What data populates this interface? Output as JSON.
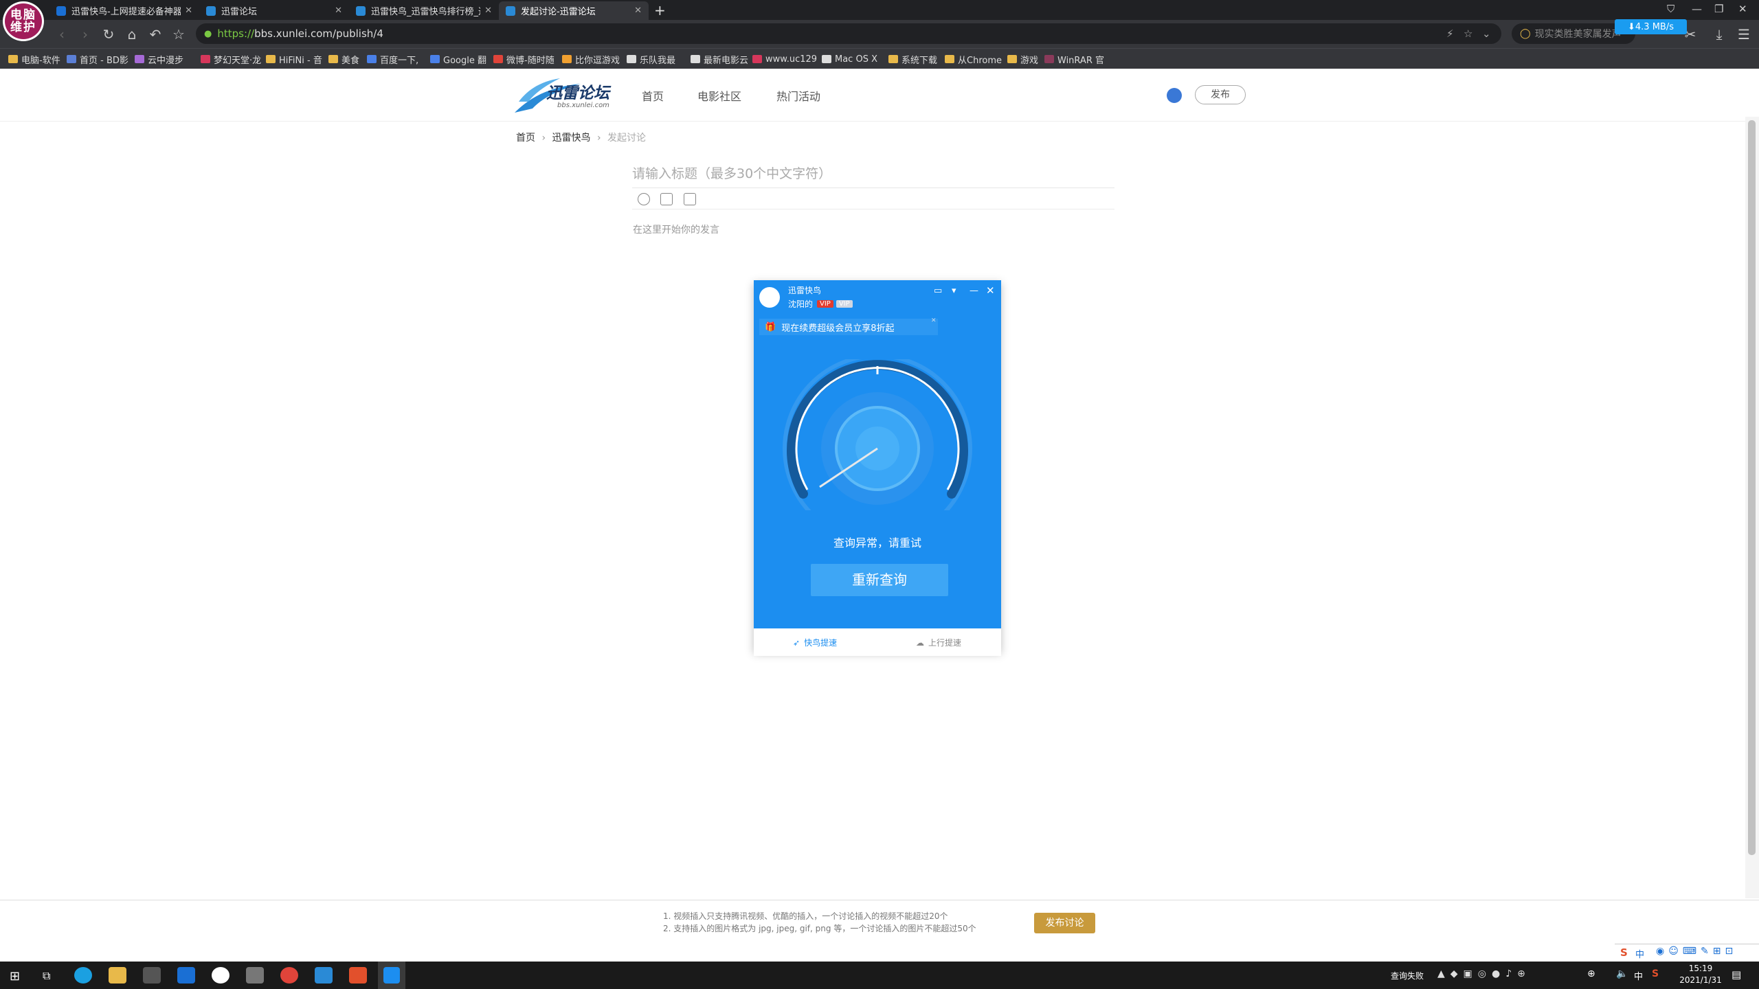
{
  "browser": {
    "badge_text": "电脑维护",
    "tabs": [
      {
        "title": "迅雷快鸟-上网提速必备神器",
        "color": "#1a6fd4"
      },
      {
        "title": "迅雷论坛",
        "color": "#2a8ad6"
      },
      {
        "title": "迅雷快鸟_迅雷快鸟排行榜_迅雷",
        "color": "#2a8ad6"
      },
      {
        "title": "发起讨论-迅雷论坛",
        "color": "#2a8ad6"
      }
    ],
    "url": "https://bbs.xunlei.com/publish/4",
    "url_scheme": "https://",
    "url_rest": "bbs.xunlei.com/publish/4",
    "search_placeholder": "现实类胜美家属发声",
    "speed_badge": "⬇4.3 MB/s",
    "bookmarks": [
      "电脑-软件",
      "首页 - BD影",
      "云中漫步",
      "梦幻天堂·龙",
      "HiFiNi - 音",
      "美食",
      "百度一下,",
      "Google 翻",
      "微博-随时随",
      "比你逗游戏",
      "乐队我最",
      "最新电影云",
      "www.uc129",
      "Mac OS X",
      "系统下载",
      "从Chrome",
      "游戏",
      "WinRAR 官"
    ]
  },
  "site": {
    "logo_text": "迅雷论坛",
    "logo_sub": "bbs.xunlei.com",
    "nav": [
      "首页",
      "电影社区",
      "热门活动"
    ],
    "publish": "发布",
    "breadcrumb": [
      "首页",
      "迅雷快鸟",
      "发起讨论"
    ],
    "title_placeholder": "请输入标题（最多30个中文字符）",
    "body_placeholder": "在这里开始你的发言",
    "footnote_1": "1. 视频插入只支持腾讯视频、优酷的插入，一个讨论插入的视频不能超过20个",
    "footnote_2": "2. 支持插入的图片格式为 jpg, jpeg, gif, png 等，一个讨论插入的图片不能超过50个",
    "submit": "发布讨论"
  },
  "popup": {
    "app_name": "迅雷快鸟",
    "user": "沈阳的",
    "vip1": "VIP",
    "vip2": "VIP",
    "promo": "现在续费超级会员立享8折起",
    "status": "查询异常，请重试",
    "retry": "重新查询",
    "tab_speedup": "快鸟提速",
    "tab_upload": "上行提速",
    "accent": "#1c8ef0"
  },
  "taskbar": {
    "status_text": "查询失败",
    "time": "15:19",
    "date": "2021/1/31",
    "ime": "中"
  }
}
